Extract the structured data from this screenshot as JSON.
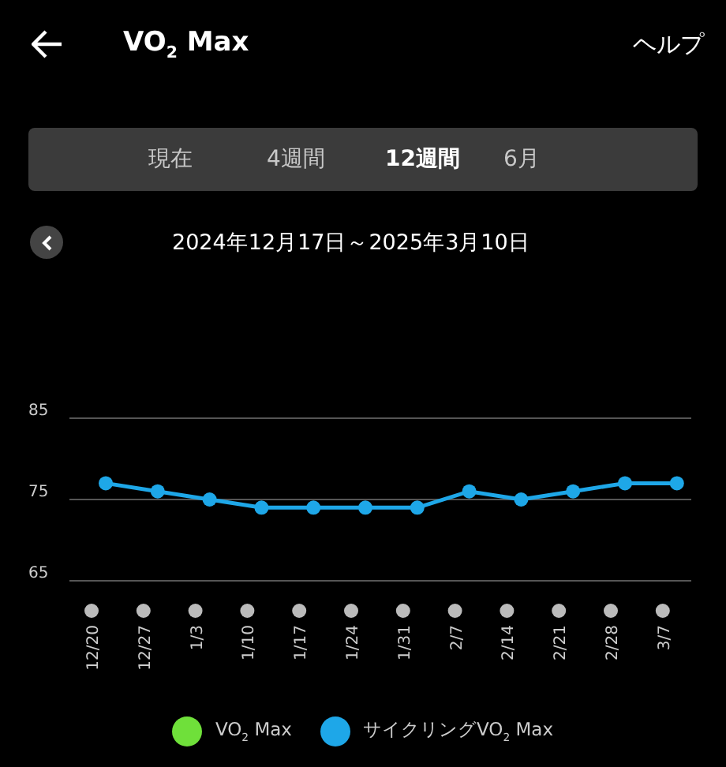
{
  "header": {
    "title": "VO$_{2}$ Max",
    "help": "ヘルプ"
  },
  "tabs": [
    {
      "label": "現在",
      "selected": false
    },
    {
      "label": "4週間",
      "selected": false
    },
    {
      "label": "12週間",
      "selected": true
    },
    {
      "label": "6月",
      "selected": false
    }
  ],
  "date_range": "2024年12月17日～2025年3月10日",
  "chart": {
    "chart_data": {
      "type": "line",
      "categories": [
        "12/20",
        "12/27",
        "1/3",
        "1/10",
        "1/17",
        "1/24",
        "1/31",
        "2/7",
        "2/14",
        "2/21",
        "2/28",
        "3/7"
      ],
      "ylim": [
        65,
        85
      ],
      "yticks": [
        65,
        75,
        85
      ],
      "series": [
        {
          "name": "VO$_{2}$ Max",
          "color": "#6fe03a",
          "values": [
            null,
            null,
            null,
            null,
            null,
            null,
            null,
            null,
            null,
            null,
            null,
            null
          ]
        },
        {
          "name": "サイクリングVO$_{2}$ Max",
          "color": "#1ea7e8",
          "marker": "o",
          "values": [
            77,
            76,
            75,
            74,
            74,
            74,
            74,
            76,
            75,
            76,
            77,
            77
          ]
        }
      ]
    }
  }
}
